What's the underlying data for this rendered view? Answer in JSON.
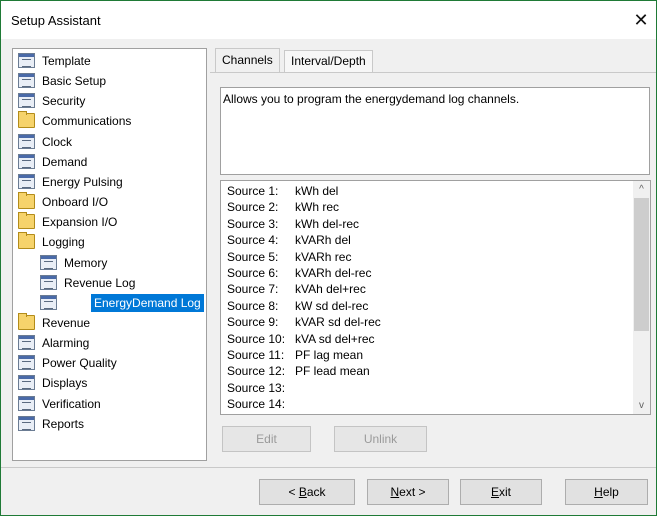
{
  "window": {
    "title": "Setup Assistant",
    "close_glyph": "✕"
  },
  "tree": {
    "items": [
      {
        "label": "Template",
        "icon": "document-icon"
      },
      {
        "label": "Basic Setup",
        "icon": "document-icon"
      },
      {
        "label": "Security",
        "icon": "document-icon"
      },
      {
        "label": "Communications",
        "icon": "folder-icon"
      },
      {
        "label": "Clock",
        "icon": "document-icon"
      },
      {
        "label": "Demand",
        "icon": "document-icon"
      },
      {
        "label": "Energy Pulsing",
        "icon": "document-icon"
      },
      {
        "label": "Onboard I/O",
        "icon": "folder-icon"
      },
      {
        "label": "Expansion I/O",
        "icon": "folder-icon"
      },
      {
        "label": "Logging",
        "icon": "folder-icon"
      },
      {
        "label": "Memory",
        "icon": "document-icon"
      },
      {
        "label": "Revenue Log",
        "icon": "document-icon"
      },
      {
        "label": "EnergyDemand Log",
        "icon": "document-icon",
        "selected": true
      },
      {
        "label": "Revenue",
        "icon": "folder-icon"
      },
      {
        "label": "Alarming",
        "icon": "document-icon"
      },
      {
        "label": "Power Quality",
        "icon": "document-icon"
      },
      {
        "label": "Displays",
        "icon": "document-icon"
      },
      {
        "label": "Verification",
        "icon": "document-icon"
      },
      {
        "label": "Reports",
        "icon": "document-icon"
      }
    ]
  },
  "tabs": [
    {
      "label": "Channels",
      "active": true
    },
    {
      "label": "Interval/Depth",
      "active": false
    }
  ],
  "description": "Allows you to program the energydemand log channels.",
  "sources": [
    {
      "label": "Source 1:",
      "value": "kWh del"
    },
    {
      "label": "Source 2:",
      "value": "kWh rec"
    },
    {
      "label": "Source 3:",
      "value": "kWh del-rec"
    },
    {
      "label": "Source 4:",
      "value": "kVARh del"
    },
    {
      "label": "Source 5:",
      "value": "kVARh rec"
    },
    {
      "label": "Source 6:",
      "value": "kVARh del-rec"
    },
    {
      "label": "Source 7:",
      "value": "kVAh del+rec"
    },
    {
      "label": "Source 8:",
      "value": "kW sd del-rec"
    },
    {
      "label": "Source 9:",
      "value": "kVAR sd del-rec"
    },
    {
      "label": "Source 10:",
      "value": "kVA sd del+rec"
    },
    {
      "label": "Source 11:",
      "value": "PF lag mean"
    },
    {
      "label": "Source 12:",
      "value": "PF lead mean"
    },
    {
      "label": "Source 13:",
      "value": ""
    },
    {
      "label": "Source 14:",
      "value": ""
    }
  ],
  "list_buttons": {
    "edit": "Edit",
    "unlink": "Unlink"
  },
  "footer": {
    "back_prefix": "< ",
    "back_key": "B",
    "back_rest": "ack",
    "next_key": "N",
    "next_rest": "ext >",
    "exit_key": "E",
    "exit_rest": "xit",
    "help_key": "H",
    "help_rest": "elp"
  },
  "scrollbar": {
    "up_glyph": "^",
    "down_glyph": "v"
  }
}
